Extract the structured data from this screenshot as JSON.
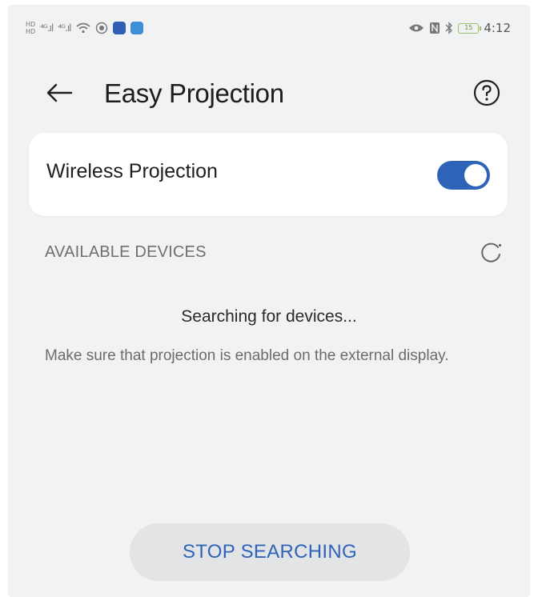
{
  "status_bar": {
    "sim1": "HD",
    "sim2": "HD",
    "signal1": "⁴ᴳ.ıl",
    "signal2": "⁴ᴳ.ıl",
    "time": "4:12",
    "battery": "15"
  },
  "header": {
    "title": "Easy Projection"
  },
  "wireless": {
    "label": "Wireless Projection",
    "enabled": true
  },
  "devices": {
    "section_label": "AVAILABLE DEVICES",
    "searching_text": "Searching for devices...",
    "hint": "Make sure that projection is enabled on the external display."
  },
  "actions": {
    "stop_label": "STOP SEARCHING"
  },
  "colors": {
    "accent": "#2f63b8",
    "background": "#f1f2f4",
    "card": "#ffffff"
  }
}
